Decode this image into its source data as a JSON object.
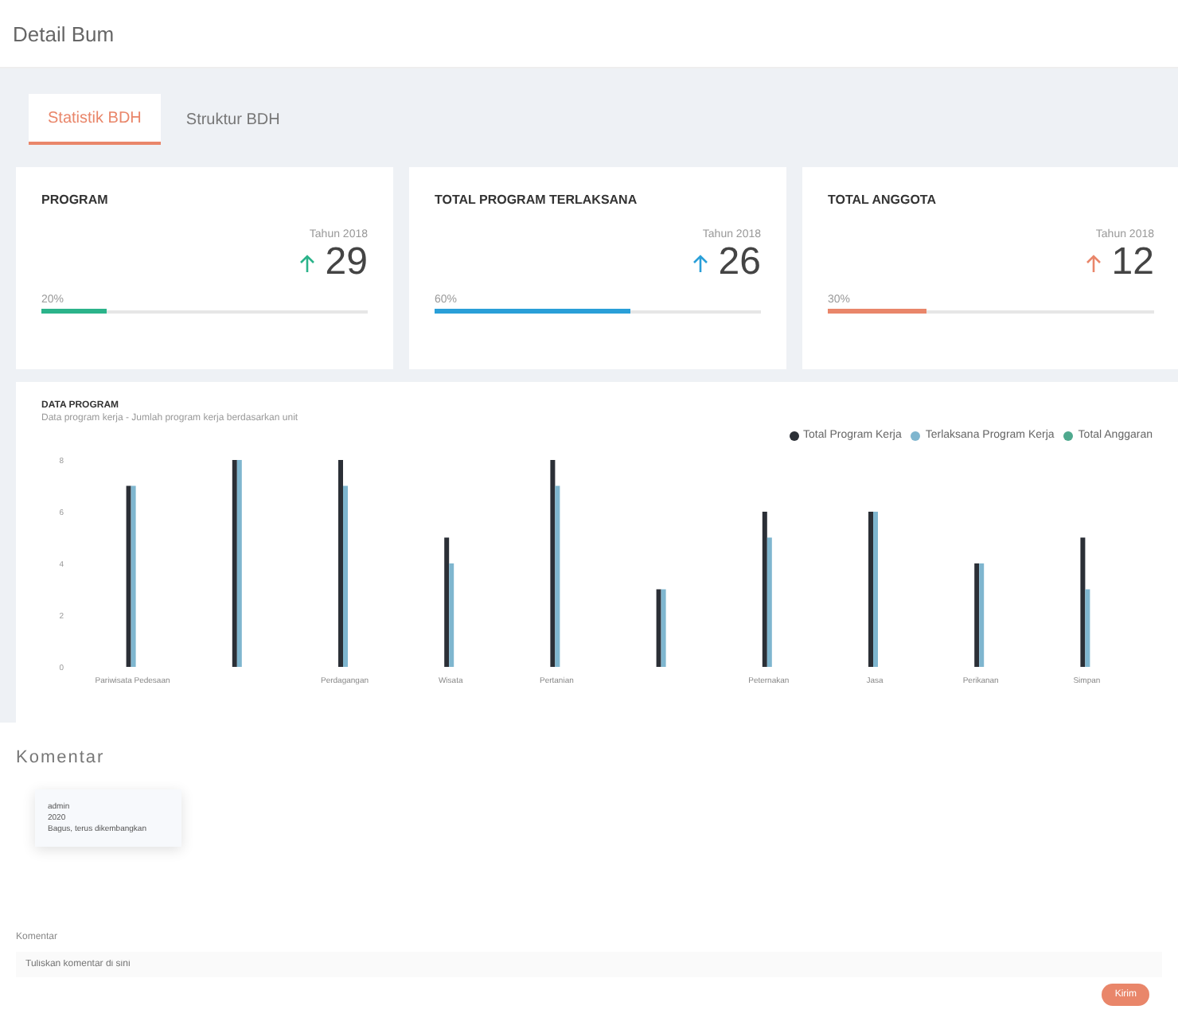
{
  "page": {
    "title": "Detail Bum"
  },
  "tabs": [
    {
      "label": "Statistik BDH",
      "selected": true
    },
    {
      "label": "Struktur BDH",
      "selected": false
    }
  ],
  "cards": [
    {
      "title": "PROGRAM",
      "caption": "Tahun 2018",
      "value": "29",
      "progress_label": "20%",
      "level": 0.2,
      "color": "#2bb38a"
    },
    {
      "title": "TOTAL PROGRAM TERLAKSANA",
      "caption": "Tahun 2018",
      "value": "26",
      "progress_label": "60%",
      "level": 0.6,
      "color": "#2a9fd8"
    },
    {
      "title": "TOTAL ANGGOTA",
      "caption": "Tahun 2018",
      "value": "12",
      "progress_label": "30%",
      "level": 0.3,
      "color": "#e9866a"
    }
  ],
  "chart": {
    "title": "DATA PROGRAM",
    "subtitle": "Data program kerja - Jumlah program kerja berdasarkan unit",
    "chart_data": {
      "type": "bar",
      "categories": [
        "Pariwisata Pedesaan",
        null,
        "Perdagangan",
        "Wisata",
        "Pertanian",
        null,
        "Peternakan",
        "Jasa",
        "Perikanan",
        "Simpan"
      ],
      "series": [
        {
          "name": "Total Program Kerja",
          "color": "#2b2f36",
          "values": [
            7,
            8,
            8,
            5,
            8,
            3,
            6,
            6,
            4,
            5
          ]
        },
        {
          "name": "Terlaksana Program Kerja",
          "color": "#7fb6cf",
          "values": [
            7,
            8,
            7,
            4,
            7,
            3,
            5,
            6,
            4,
            3
          ]
        },
        {
          "name": "Total Anggaran",
          "color": "#4fa98e",
          "values": [
            0,
            0,
            0,
            0,
            0,
            0,
            0,
            0,
            0,
            0
          ]
        }
      ],
      "ylim": [
        0,
        8
      ],
      "yticks": [
        0,
        2,
        4,
        6,
        8
      ]
    }
  },
  "comments": {
    "title": "Komentar",
    "items": [
      {
        "author": "admin",
        "date": "2020",
        "text": "Bagus, terus dikembangkan"
      }
    ],
    "input_label": "Komentar",
    "input": {
      "placeholder": "Tuliskan komentar di sini"
    },
    "send_button": "Kirim"
  }
}
